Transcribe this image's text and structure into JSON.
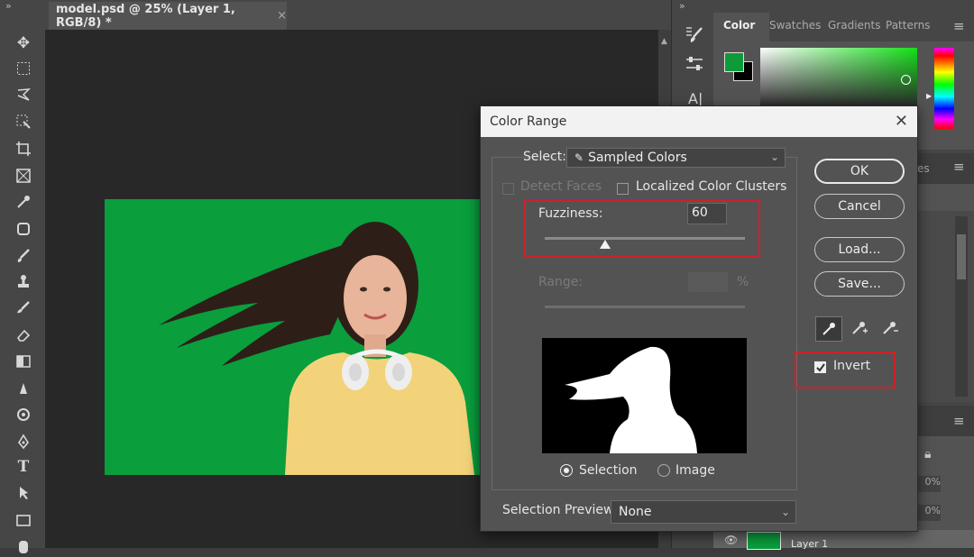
{
  "app": {
    "doc_tab_title": "model.psd @ 25% (Layer 1, RGB/8) *",
    "doc_tab_close": "×",
    "collapse_left": "»",
    "collapse_right": "»"
  },
  "color_panel": {
    "tabs": [
      "Color",
      "Swatches",
      "Gradients",
      "Patterns"
    ],
    "menu_icon": "≡",
    "foreground_color": "#0f9a3a",
    "background_color": "#000000"
  },
  "layers_panel": {
    "layer_name": "Layer 1",
    "percent_1": "0%",
    "percent_2": "0%",
    "fragment": "es"
  },
  "dialog": {
    "title": "Color Range",
    "close": "✕",
    "select_label": "Select:",
    "select_value": "Sampled Colors",
    "detect_faces_label": "Detect Faces",
    "localized_label": "Localized Color Clusters",
    "fuzziness_label": "Fuzziness:",
    "fuzziness_value": "60",
    "fuzziness_level": 0.3,
    "range_label": "Range:",
    "range_unit": "%",
    "selection_radio": "Selection",
    "image_radio": "Image",
    "selection_preview_label": "Selection Preview:",
    "selection_preview_value": "None",
    "ok": "OK",
    "cancel": "Cancel",
    "load": "Load...",
    "save": "Save...",
    "invert_label": "Invert",
    "invert_checked": true
  },
  "colors": {
    "highlight_red": "#d0202a",
    "green_screen": "#0a9e3d"
  }
}
